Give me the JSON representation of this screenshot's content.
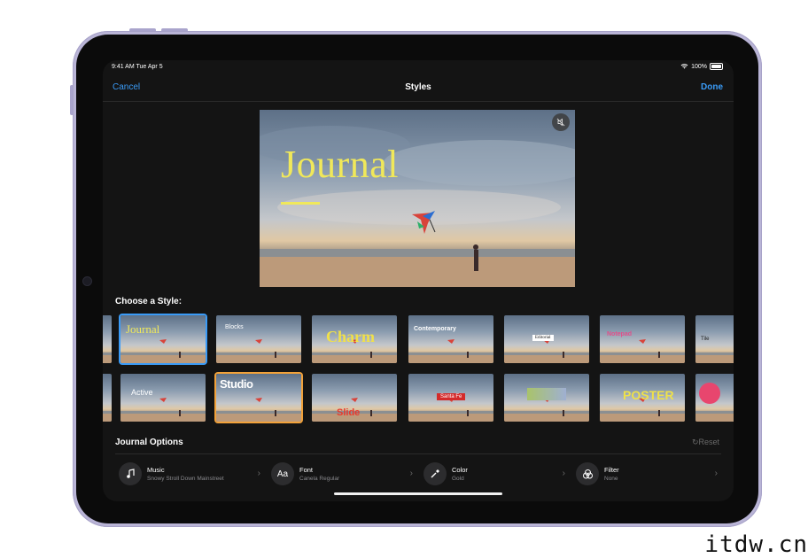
{
  "status_bar": {
    "time": "9:41 AM  Tue Apr 5",
    "battery": "100%"
  },
  "nav": {
    "cancel": "Cancel",
    "title": "Styles",
    "done": "Done"
  },
  "preview": {
    "title": "Journal",
    "title_color": "#f0e85a"
  },
  "styles": {
    "section_title": "Choose a Style:",
    "row1": [
      {
        "label": "",
        "type": "partial"
      },
      {
        "label": "Journal",
        "type": "journal",
        "selected": true
      },
      {
        "label": "Blocks",
        "type": "blocks"
      },
      {
        "label": "Charm",
        "type": "charm"
      },
      {
        "label": "Contemporary",
        "type": "contemporary"
      },
      {
        "label": "Editorial",
        "type": "editorial"
      },
      {
        "label": "Notepad",
        "type": "notepad"
      },
      {
        "label": "Tile",
        "type": "tile"
      }
    ],
    "row2": [
      {
        "label": "",
        "type": "partial"
      },
      {
        "label": "Active",
        "type": "active"
      },
      {
        "label": "Studio",
        "type": "studio",
        "focused": true
      },
      {
        "label": "Slide",
        "type": "slide"
      },
      {
        "label": "Santa Fe",
        "type": "santafe"
      },
      {
        "label": "",
        "type": "gradient"
      },
      {
        "label": "POSTER",
        "type": "poster"
      },
      {
        "label": "",
        "type": "dots"
      }
    ]
  },
  "options": {
    "title": "Journal Options",
    "reset": "Reset",
    "items": [
      {
        "name": "Music",
        "value": "Snowy Stroll Down Mainstreet",
        "icon": "music-note-icon"
      },
      {
        "name": "Font",
        "value": "Canela Regular",
        "icon": "font-aa-icon"
      },
      {
        "name": "Color",
        "value": "Gold",
        "icon": "eyedropper-icon"
      },
      {
        "name": "Filter",
        "value": "None",
        "icon": "filter-icon"
      }
    ]
  },
  "watermark": "itdw.cn",
  "colors": {
    "accent": "#3a9bf7",
    "selected_outline": "#3a9bf7",
    "focus_outline": "#f2a23a"
  }
}
